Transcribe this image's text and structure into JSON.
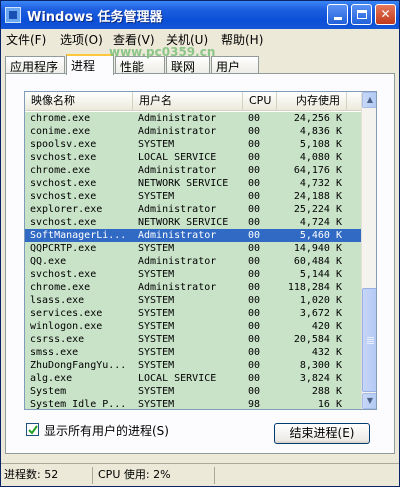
{
  "window": {
    "title": "Windows 任务管理器",
    "controls": {
      "minimize": "minimize-icon",
      "maximize": "maximize-icon",
      "close": "close-icon"
    }
  },
  "menu": [
    "文件(F)",
    "选项(O)",
    "查看(V)",
    "关机(U)",
    "帮助(H)"
  ],
  "tabs": [
    "应用程序",
    "进程",
    "性能",
    "联网",
    "用户"
  ],
  "active_tab": "进程",
  "watermark": "www.pc0359.cn",
  "list": {
    "columns": [
      "映像名称",
      "用户名",
      "CPU",
      "内存使用"
    ],
    "rows": [
      [
        "chrome.exe",
        "Administrator",
        "00",
        "24,256 K"
      ],
      [
        "conime.exe",
        "Administrator",
        "00",
        "4,836 K"
      ],
      [
        "spoolsv.exe",
        "SYSTEM",
        "00",
        "5,108 K"
      ],
      [
        "svchost.exe",
        "LOCAL SERVICE",
        "00",
        "4,080 K"
      ],
      [
        "chrome.exe",
        "Administrator",
        "00",
        "64,176 K"
      ],
      [
        "svchost.exe",
        "NETWORK SERVICE",
        "00",
        "4,732 K"
      ],
      [
        "svchost.exe",
        "SYSTEM",
        "00",
        "24,188 K"
      ],
      [
        "explorer.exe",
        "Administrator",
        "00",
        "25,224 K"
      ],
      [
        "svchost.exe",
        "NETWORK SERVICE",
        "00",
        "4,724 K"
      ],
      [
        "SoftManagerLi...",
        "Administrator",
        "00",
        "5,460 K"
      ],
      [
        "QQPCRTP.exe",
        "SYSTEM",
        "00",
        "14,940 K"
      ],
      [
        "QQ.exe",
        "Administrator",
        "00",
        "60,484 K"
      ],
      [
        "svchost.exe",
        "SYSTEM",
        "00",
        "5,144 K"
      ],
      [
        "chrome.exe",
        "Administrator",
        "00",
        "118,284 K"
      ],
      [
        "lsass.exe",
        "SYSTEM",
        "00",
        "1,020 K"
      ],
      [
        "services.exe",
        "SYSTEM",
        "00",
        "3,672 K"
      ],
      [
        "winlogon.exe",
        "SYSTEM",
        "00",
        "420 K"
      ],
      [
        "csrss.exe",
        "SYSTEM",
        "00",
        "20,584 K"
      ],
      [
        "smss.exe",
        "SYSTEM",
        "00",
        "432 K"
      ],
      [
        "ZhuDongFangYu...",
        "SYSTEM",
        "00",
        "8,300 K"
      ],
      [
        "alg.exe",
        "LOCAL SERVICE",
        "00",
        "3,824 K"
      ],
      [
        "System",
        "SYSTEM",
        "00",
        "288 K"
      ],
      [
        "System Idle P...",
        "SYSTEM",
        "98",
        "16 K"
      ]
    ],
    "selected_index": 9
  },
  "show_all_users": {
    "label": "显示所有用户的进程(S)",
    "checked": true
  },
  "end_process_button": "结束进程(E)",
  "status": {
    "processes": "进程数: 52",
    "cpu": "CPU 使用: 2%"
  }
}
